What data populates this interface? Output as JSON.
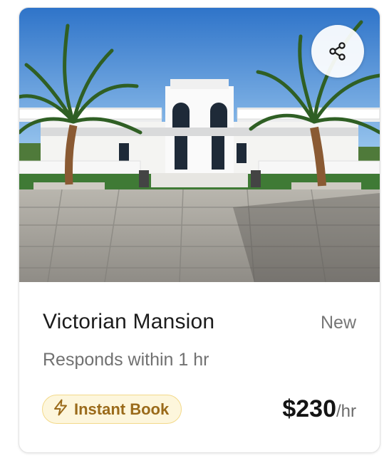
{
  "listing": {
    "title": "Victorian Mansion",
    "status": "New",
    "response_time": "Responds within 1 hr",
    "badge": {
      "label": "Instant Book",
      "icon": "lightning-icon"
    },
    "price": {
      "amount": "$230",
      "unit": "/hr"
    },
    "photo": {
      "alt": "White mansion with palm trees and stone-paved courtyard"
    }
  },
  "actions": {
    "share": {
      "icon": "share-icon"
    }
  },
  "colors": {
    "badge_bg": "#fdf6dc",
    "badge_border": "#f3d98a",
    "badge_text": "#9a6a1a",
    "price_text": "#141414"
  }
}
